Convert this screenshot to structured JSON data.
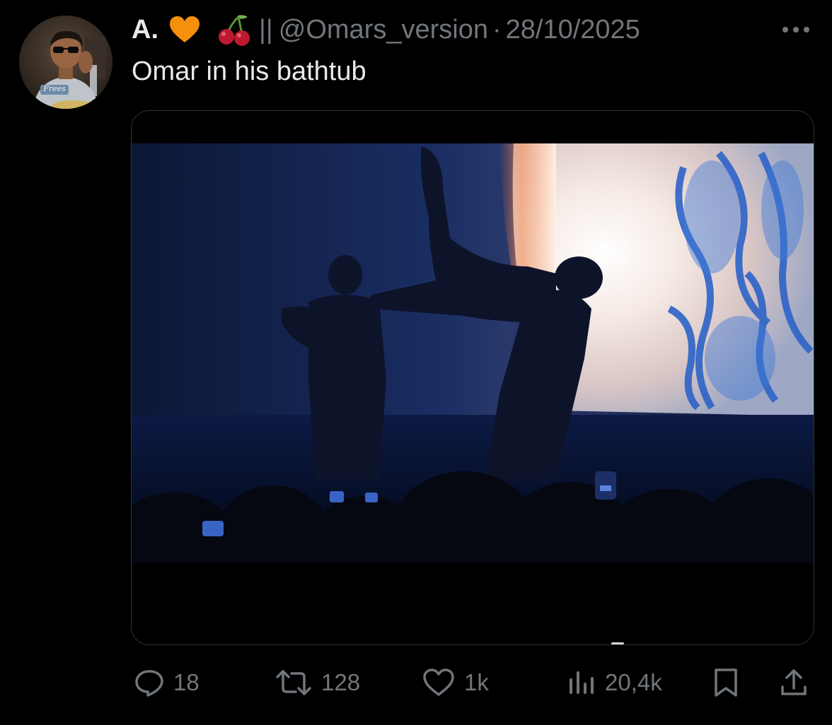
{
  "tweet": {
    "display_name": "A.",
    "name_emojis": [
      "orange-heart-icon",
      "cherries-icon"
    ],
    "separator": "||",
    "handle": "@Omars_version",
    "dot": "·",
    "date": "28/10/2025",
    "text": "Omar in his bathtub",
    "avatar_shirt_text": "Frees"
  },
  "actions": {
    "replies": "18",
    "reposts": "128",
    "likes": "1k",
    "views": "20,4k"
  },
  "colors": {
    "background": "#000000",
    "primary_text": "#e7e9ea",
    "secondary_text": "#71767b",
    "border": "#2f3336",
    "heart_emoji": "#f4900c",
    "cherries": "#be1931"
  }
}
